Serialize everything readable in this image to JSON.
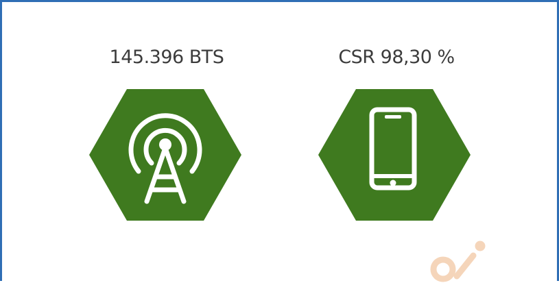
{
  "colors": {
    "hexagon_fill": "#3f7a1f",
    "icon_stroke": "#ffffff",
    "frame_border": "#2f6eb5",
    "text": "#3c3c3c"
  },
  "stats": [
    {
      "label": "145.396 BTS",
      "icon": "cell-tower-icon"
    },
    {
      "label": "CSR 98,30 %",
      "icon": "smartphone-icon"
    }
  ]
}
